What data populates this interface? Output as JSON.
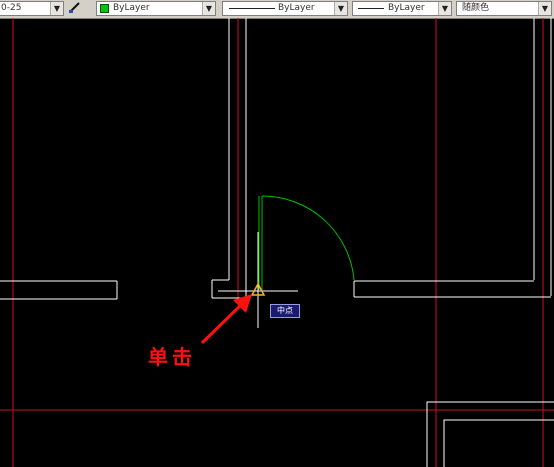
{
  "toolbar": {
    "style_value": "0-25",
    "layer_color_value": "ByLayer",
    "linetype_value": "ByLayer",
    "lineweight_value": "ByLayer",
    "plot_color_value": "随颜色",
    "dropdown_arrow": "▼",
    "brush_icon": "paint-brush-icon"
  },
  "canvas": {
    "background": "#000000",
    "wall_color": "#ffffff",
    "guide_color": "#c8102e",
    "door_color": "#00c000"
  },
  "snap_tooltip": {
    "label": "中点"
  },
  "annotation": {
    "text": "单击",
    "color": "#ff1010"
  }
}
